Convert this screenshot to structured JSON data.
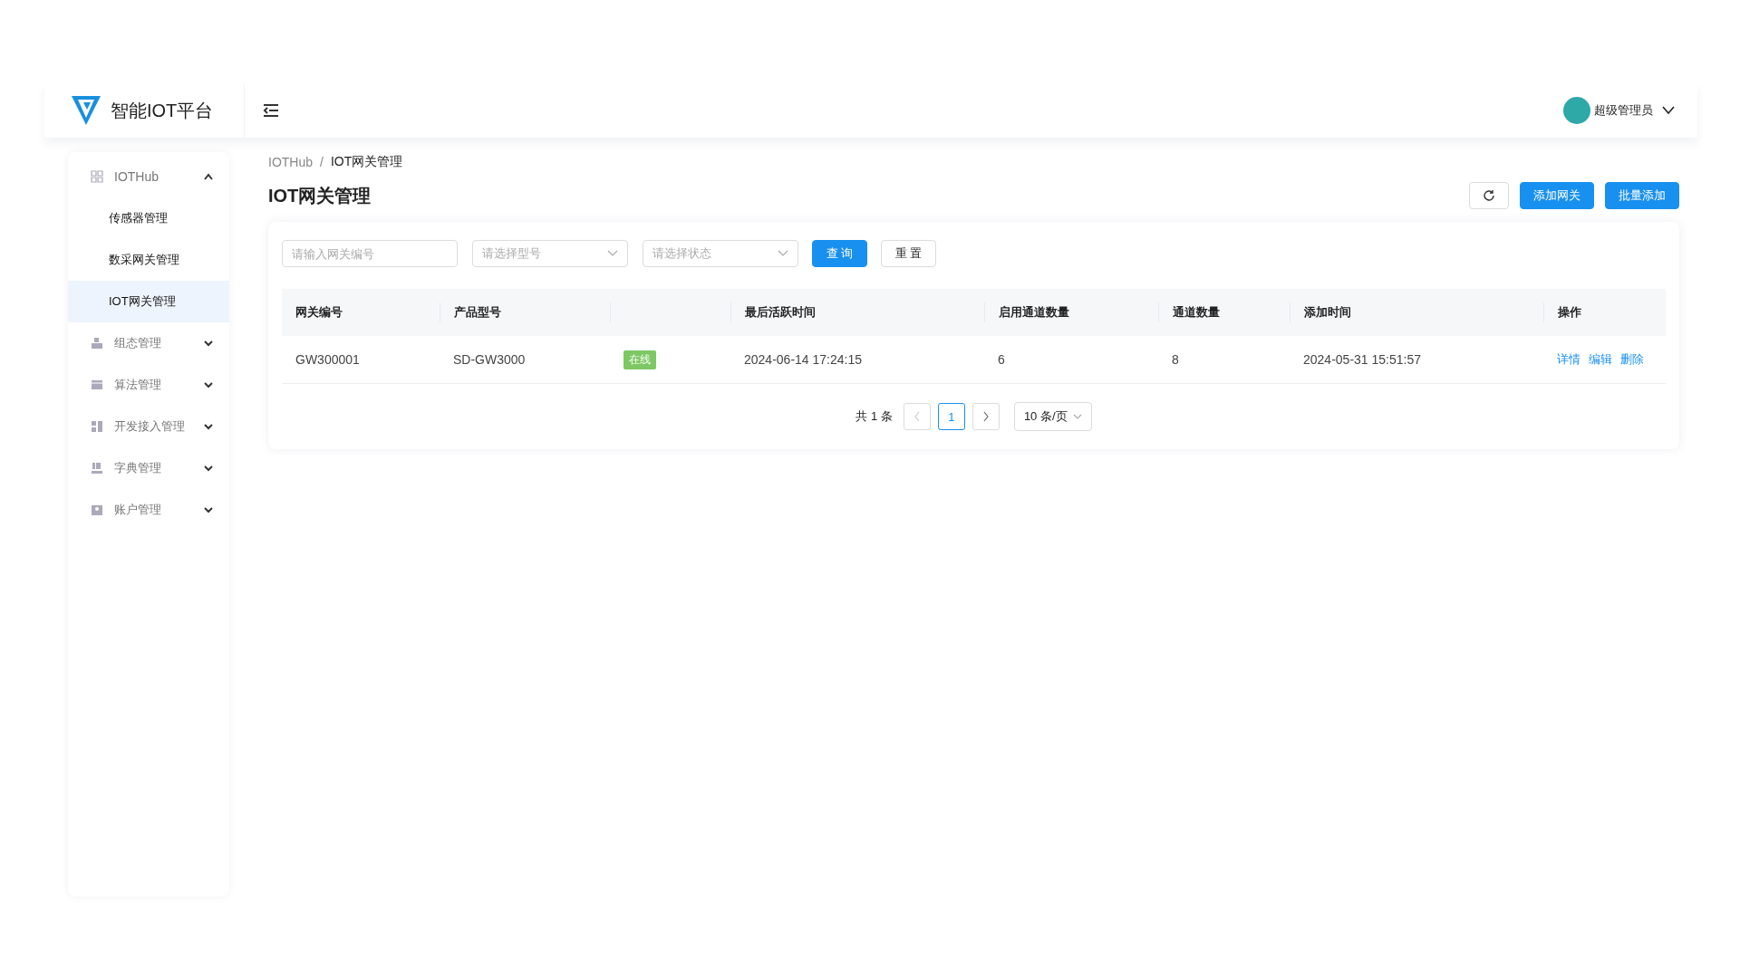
{
  "header": {
    "app_name": "智能IOT平台",
    "user": {
      "name": "超级管理员"
    }
  },
  "sidebar": {
    "items": [
      {
        "label": "IOTHub",
        "expanded": true,
        "children": [
          {
            "label": "传感器管理",
            "selected": false
          },
          {
            "label": "数采网关管理",
            "selected": false
          },
          {
            "label": "IOT网关管理",
            "selected": true
          }
        ]
      },
      {
        "label": "组态管理",
        "expanded": false
      },
      {
        "label": "算法管理",
        "expanded": false
      },
      {
        "label": "开发接入管理",
        "expanded": false
      },
      {
        "label": "字典管理",
        "expanded": false
      },
      {
        "label": "账户管理",
        "expanded": false
      }
    ]
  },
  "breadcrumb": {
    "items": [
      "IOTHub",
      "IOT网关管理"
    ],
    "separator": "/"
  },
  "page_title": "IOT网关管理",
  "actions": [
    "添加网关",
    "批量添加"
  ],
  "filters": {
    "gateway_field": {
      "placeholder": "请输入网关编号"
    },
    "model_select": {
      "placeholder": "请选择型号"
    },
    "status_select": {
      "placeholder": "请选择状态"
    },
    "buttons": [
      "查 询",
      "重 置"
    ]
  },
  "table": {
    "columns": [
      {
        "label": "网关编号"
      },
      {
        "label": "产品型号"
      },
      {},
      {
        "label": "最后活跃时间"
      },
      {
        "label": "启用通道数量"
      },
      {
        "label": "通道数量"
      },
      {
        "label": "添加时间"
      },
      {
        "label": "操作"
      }
    ],
    "rows": [
      {
        "gateway_id": "GW300001",
        "model": "SD-GW3000",
        "status": {
          "text": "在线",
          "online": true
        },
        "last_active": "2024-06-14 17:24:15",
        "enabled_channels": "6",
        "channels": "8",
        "added_time": "2024-05-31 15:51:57",
        "actions": [
          "详情",
          "编辑",
          "删除"
        ]
      }
    ]
  },
  "pagination": {
    "total": "共 1 条",
    "pages": [
      {
        "label": "1",
        "selected": true
      }
    ],
    "prev_disabled": true,
    "next_disabled": false,
    "page_size": "10 条/页"
  }
}
